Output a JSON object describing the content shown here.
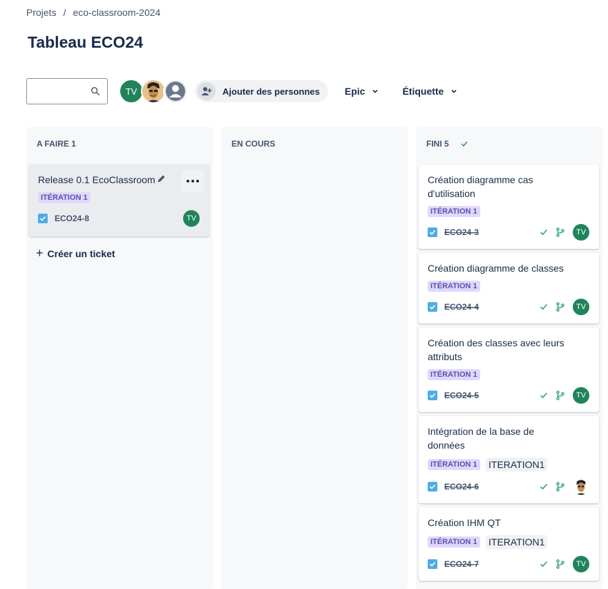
{
  "breadcrumb": {
    "root": "Projets",
    "separator": "/",
    "project": "eco-classroom-2024"
  },
  "page": {
    "title": "Tableau ECO24"
  },
  "toolbar": {
    "search_value": "",
    "avatar_tv": "TV",
    "add_people_label": "Ajouter des personnes",
    "epic_label": "Epic",
    "etiquette_label": "Étiquette"
  },
  "columns": [
    {
      "title": "A FAIRE 1",
      "cards": [
        {
          "title": "Release 0.1 EcoClassroom",
          "lozenge": "ITÉRATION 1",
          "key": "ECO24-8",
          "assignee": "TV"
        }
      ],
      "create_label": "Créer un ticket"
    },
    {
      "title": "EN COURS",
      "cards": []
    },
    {
      "title": "FINI 5",
      "cards": [
        {
          "title": "Création diagramme cas d'utilisation",
          "lozenge": "ITÉRATION 1",
          "key": "ECO24-3",
          "assignee": "TV"
        },
        {
          "title": "Création diagramme de classes",
          "lozenge": "ITÉRATION 1",
          "key": "ECO24-4",
          "assignee": "TV"
        },
        {
          "title": "Création des classes avec leurs attributs",
          "lozenge": "ITÉRATION 1",
          "key": "ECO24-5",
          "assignee": "TV"
        },
        {
          "title": "Intégration de la base de données",
          "lozenge": "ITÉRATION 1",
          "label": "ITERATION1",
          "key": "ECO24-6",
          "assignee": ""
        },
        {
          "title": "Création IHM QT",
          "lozenge": "ITÉRATION 1",
          "label": "ITERATION1",
          "key": "ECO24-7",
          "assignee": "TV"
        }
      ]
    }
  ],
  "colors": {
    "accent": "#1f845a",
    "lozenge_bg": "#dfd8fd",
    "lozenge_text": "#5e4db2",
    "checkbox": "#1d7afc",
    "done_check": "#22a06b"
  }
}
